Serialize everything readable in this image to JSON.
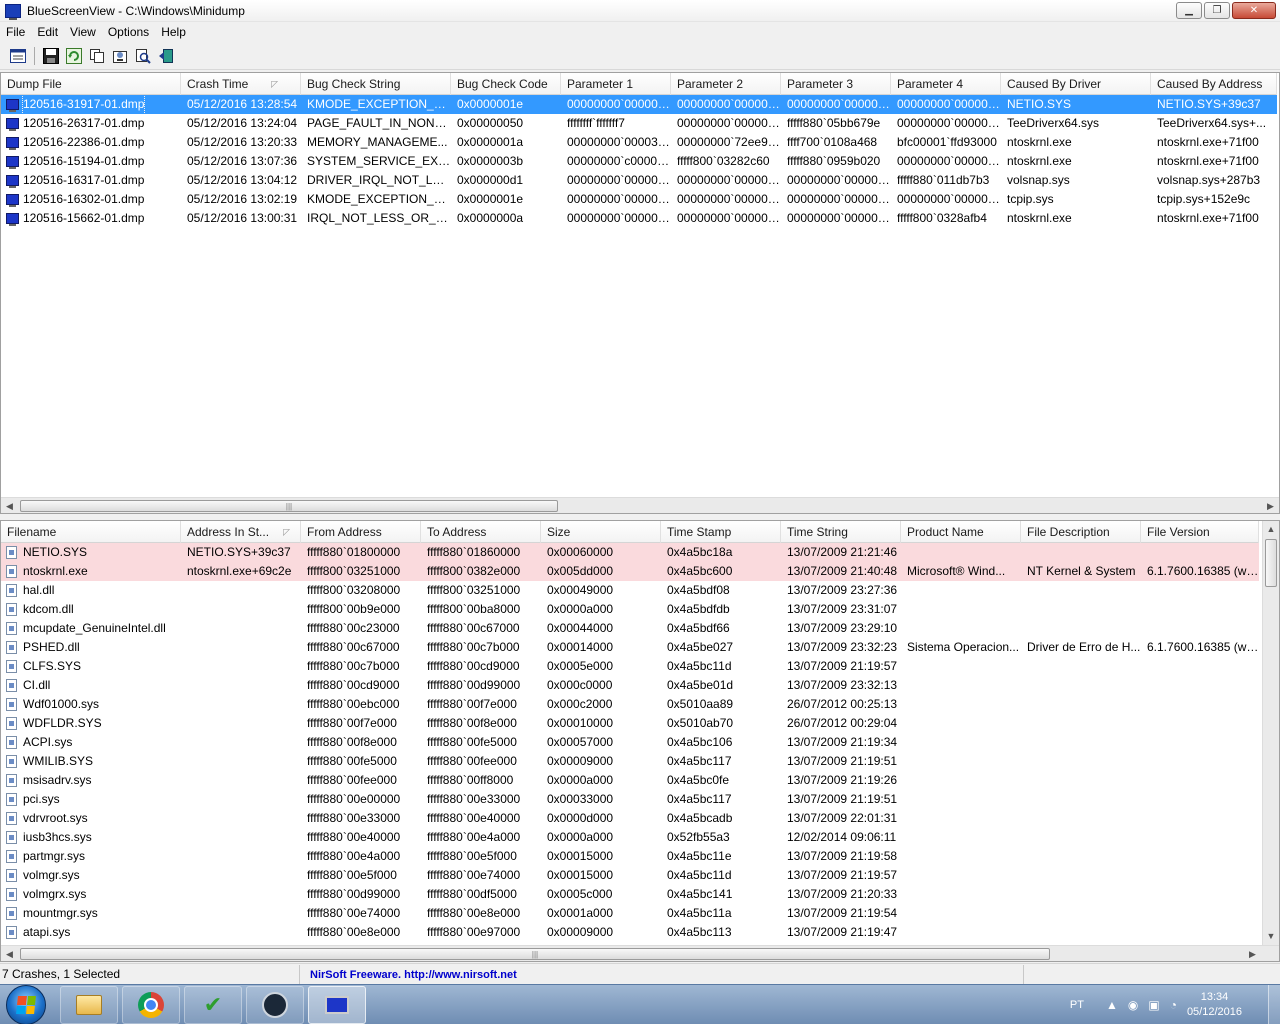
{
  "window": {
    "title": "BlueScreenView  -  C:\\Windows\\Minidump",
    "minimize": "▁",
    "maximize": "❐",
    "close": "✕"
  },
  "menu": [
    "File",
    "Edit",
    "View",
    "Options",
    "Help"
  ],
  "toolbar_icons": [
    "properties-icon",
    "save-icon",
    "refresh-icon",
    "copy-icon",
    "advanced-options-icon",
    "find-icon",
    "exit-icon"
  ],
  "crash_list": {
    "columns": [
      "Dump File",
      "Crash Time",
      "Bug Check String",
      "Bug Check Code",
      "Parameter 1",
      "Parameter 2",
      "Parameter 3",
      "Parameter 4",
      "Caused By Driver",
      "Caused By Address"
    ],
    "sorted_column": "Crash Time",
    "sort_glyph": "◸",
    "rows": [
      [
        "120516-31917-01.dmp",
        "05/12/2016 13:28:54",
        "KMODE_EXCEPTION_N...",
        "0x0000001e",
        "00000000`000000...",
        "00000000`000000...",
        "00000000`000000...",
        "00000000`000000...",
        "NETIO.SYS",
        "NETIO.SYS+39c37"
      ],
      [
        "120516-26317-01.dmp",
        "05/12/2016 13:24:04",
        "PAGE_FAULT_IN_NONP...",
        "0x00000050",
        "ffffffff`fffffff7",
        "00000000`000000...",
        "fffff880`05bb679e",
        "00000000`000000...",
        "TeeDriverx64.sys",
        "TeeDriverx64.sys+..."
      ],
      [
        "120516-22386-01.dmp",
        "05/12/2016 13:20:33",
        "MEMORY_MANAGEME...",
        "0x0000001a",
        "00000000`000034...",
        "00000000`72ee90...",
        "ffff700`0108a468",
        "bfc00001`ffd93000",
        "ntoskrnl.exe",
        "ntoskrnl.exe+71f00"
      ],
      [
        "120516-15194-01.dmp",
        "05/12/2016 13:07:36",
        "SYSTEM_SERVICE_EXCE...",
        "0x0000003b",
        "00000000`c00000...",
        "fffff800`03282c60",
        "fffff880`0959b020",
        "00000000`000000...",
        "ntoskrnl.exe",
        "ntoskrnl.exe+71f00"
      ],
      [
        "120516-16317-01.dmp",
        "05/12/2016 13:04:12",
        "DRIVER_IRQL_NOT_LESS...",
        "0x000000d1",
        "00000000`000000...",
        "00000000`000000...",
        "00000000`000000...",
        "fffff880`011db7b3",
        "volsnap.sys",
        "volsnap.sys+287b3"
      ],
      [
        "120516-16302-01.dmp",
        "05/12/2016 13:02:19",
        "KMODE_EXCEPTION_N...",
        "0x0000001e",
        "00000000`000000...",
        "00000000`000000...",
        "00000000`000000...",
        "00000000`000000...",
        "tcpip.sys",
        "tcpip.sys+152e9c"
      ],
      [
        "120516-15662-01.dmp",
        "05/12/2016 13:00:31",
        "IRQL_NOT_LESS_OR_EQ...",
        "0x0000000a",
        "00000000`000000...",
        "00000000`000000...",
        "00000000`000000...",
        "fffff800`0328afb4",
        "ntoskrnl.exe",
        "ntoskrnl.exe+71f00"
      ]
    ],
    "selected_row": 0
  },
  "driver_list": {
    "columns": [
      "Filename",
      "Address In St...",
      "From Address",
      "To Address",
      "Size",
      "Time Stamp",
      "Time String",
      "Product Name",
      "File Description",
      "File Version"
    ],
    "sort_glyph": "◸",
    "rows": [
      [
        "NETIO.SYS",
        "NETIO.SYS+39c37",
        "fffff880`01800000",
        "fffff880`01860000",
        "0x00060000",
        "0x4a5bc18a",
        "13/07/2009 21:21:46",
        "",
        "",
        ""
      ],
      [
        "ntoskrnl.exe",
        "ntoskrnl.exe+69c2e",
        "fffff800`03251000",
        "fffff800`0382e000",
        "0x005dd000",
        "0x4a5bc600",
        "13/07/2009 21:40:48",
        "Microsoft® Wind...",
        "NT Kernel & System",
        "6.1.7600.16385 (wi..."
      ],
      [
        "hal.dll",
        "",
        "fffff800`03208000",
        "fffff800`03251000",
        "0x00049000",
        "0x4a5bdf08",
        "13/07/2009 23:27:36",
        "",
        "",
        ""
      ],
      [
        "kdcom.dll",
        "",
        "fffff800`00b9e000",
        "fffff800`00ba8000",
        "0x0000a000",
        "0x4a5bdfdb",
        "13/07/2009 23:31:07",
        "",
        "",
        ""
      ],
      [
        "mcupdate_GenuineIntel.dll",
        "",
        "fffff880`00c23000",
        "fffff880`00c67000",
        "0x00044000",
        "0x4a5bdf66",
        "13/07/2009 23:29:10",
        "",
        "",
        ""
      ],
      [
        "PSHED.dll",
        "",
        "fffff880`00c67000",
        "fffff880`00c7b000",
        "0x00014000",
        "0x4a5be027",
        "13/07/2009 23:32:23",
        "Sistema Operacion...",
        "Driver de Erro de H...",
        "6.1.7600.16385 (wi..."
      ],
      [
        "CLFS.SYS",
        "",
        "fffff880`00c7b000",
        "fffff880`00cd9000",
        "0x0005e000",
        "0x4a5bc11d",
        "13/07/2009 21:19:57",
        "",
        "",
        ""
      ],
      [
        "CI.dll",
        "",
        "fffff880`00cd9000",
        "fffff880`00d99000",
        "0x000c0000",
        "0x4a5be01d",
        "13/07/2009 23:32:13",
        "",
        "",
        ""
      ],
      [
        "Wdf01000.sys",
        "",
        "fffff880`00ebc000",
        "fffff880`00f7e000",
        "0x000c2000",
        "0x5010aa89",
        "26/07/2012 00:25:13",
        "",
        "",
        ""
      ],
      [
        "WDFLDR.SYS",
        "",
        "fffff880`00f7e000",
        "fffff880`00f8e000",
        "0x00010000",
        "0x5010ab70",
        "26/07/2012 00:29:04",
        "",
        "",
        ""
      ],
      [
        "ACPI.sys",
        "",
        "fffff880`00f8e000",
        "fffff880`00fe5000",
        "0x00057000",
        "0x4a5bc106",
        "13/07/2009 21:19:34",
        "",
        "",
        ""
      ],
      [
        "WMILIB.SYS",
        "",
        "fffff880`00fe5000",
        "fffff880`00fee000",
        "0x00009000",
        "0x4a5bc117",
        "13/07/2009 21:19:51",
        "",
        "",
        ""
      ],
      [
        "msisadrv.sys",
        "",
        "fffff880`00fee000",
        "fffff880`00ff8000",
        "0x0000a000",
        "0x4a5bc0fe",
        "13/07/2009 21:19:26",
        "",
        "",
        ""
      ],
      [
        "pci.sys",
        "",
        "fffff880`00e00000",
        "fffff880`00e33000",
        "0x00033000",
        "0x4a5bc117",
        "13/07/2009 21:19:51",
        "",
        "",
        ""
      ],
      [
        "vdrvroot.sys",
        "",
        "fffff880`00e33000",
        "fffff880`00e40000",
        "0x0000d000",
        "0x4a5bcadb",
        "13/07/2009 22:01:31",
        "",
        "",
        ""
      ],
      [
        "iusb3hcs.sys",
        "",
        "fffff880`00e40000",
        "fffff880`00e4a000",
        "0x0000a000",
        "0x52fb55a3",
        "12/02/2014 09:06:11",
        "",
        "",
        ""
      ],
      [
        "partmgr.sys",
        "",
        "fffff880`00e4a000",
        "fffff880`00e5f000",
        "0x00015000",
        "0x4a5bc11e",
        "13/07/2009 21:19:58",
        "",
        "",
        ""
      ],
      [
        "volmgr.sys",
        "",
        "fffff880`00e5f000",
        "fffff880`00e74000",
        "0x00015000",
        "0x4a5bc11d",
        "13/07/2009 21:19:57",
        "",
        "",
        ""
      ],
      [
        "volmgrx.sys",
        "",
        "fffff880`00d99000",
        "fffff880`00df5000",
        "0x0005c000",
        "0x4a5bc141",
        "13/07/2009 21:20:33",
        "",
        "",
        ""
      ],
      [
        "mountmgr.sys",
        "",
        "fffff880`00e74000",
        "fffff880`00e8e000",
        "0x0001a000",
        "0x4a5bc11a",
        "13/07/2009 21:19:54",
        "",
        "",
        ""
      ],
      [
        "atapi.sys",
        "",
        "fffff880`00e8e000",
        "fffff880`00e97000",
        "0x00009000",
        "0x4a5bc113",
        "13/07/2009 21:19:47",
        "",
        "",
        ""
      ]
    ],
    "highlighted_rows": [
      0,
      1
    ]
  },
  "scroll_glyphs": {
    "left": "◀",
    "right": "▶",
    "up": "▲",
    "down": "▼",
    "grip": "|||"
  },
  "status": {
    "count": "7 Crashes, 1 Selected",
    "link": "NirSoft Freeware.  http://www.nirsoft.net"
  },
  "taskbar": {
    "apps": [
      "explorer-icon",
      "chrome-icon",
      "checkmark-app-icon",
      "steam-icon",
      "bluescreenview-icon"
    ],
    "check_glyph": "✔",
    "language": "PT",
    "tray_glyphs": [
      "▲",
      "◉",
      "▣",
      "◔"
    ],
    "time": "13:34",
    "date": "05/12/2016"
  },
  "colors": {
    "selection": "#3399ff",
    "highlight_row": "#fadadd",
    "link": "#0000cc"
  }
}
